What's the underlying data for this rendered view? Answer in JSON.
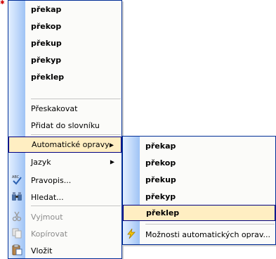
{
  "main_menu": {
    "suggestions": [
      "překap",
      "překop",
      "překup",
      "překyp",
      "překlep"
    ],
    "items": {
      "ignore": "Přeskakovat",
      "add_to_dictionary": "Přidat do slovníku",
      "autocorrect": "Automatické opravy",
      "language": "Jazyk",
      "spelling": "Pravopis...",
      "find": "Hledat...",
      "cut": "Vyjmout",
      "copy": "Kopírovat",
      "paste": "Vložit"
    }
  },
  "submenu": {
    "suggestions": [
      "překap",
      "překop",
      "překup",
      "překyp",
      "překlep"
    ],
    "options": "Možnosti automatických oprav..."
  },
  "colors": {
    "border": "#002d96",
    "highlight": "#ffeec2",
    "gutter": "#c6dcfb",
    "disabled_text": "#8b8b8b"
  }
}
